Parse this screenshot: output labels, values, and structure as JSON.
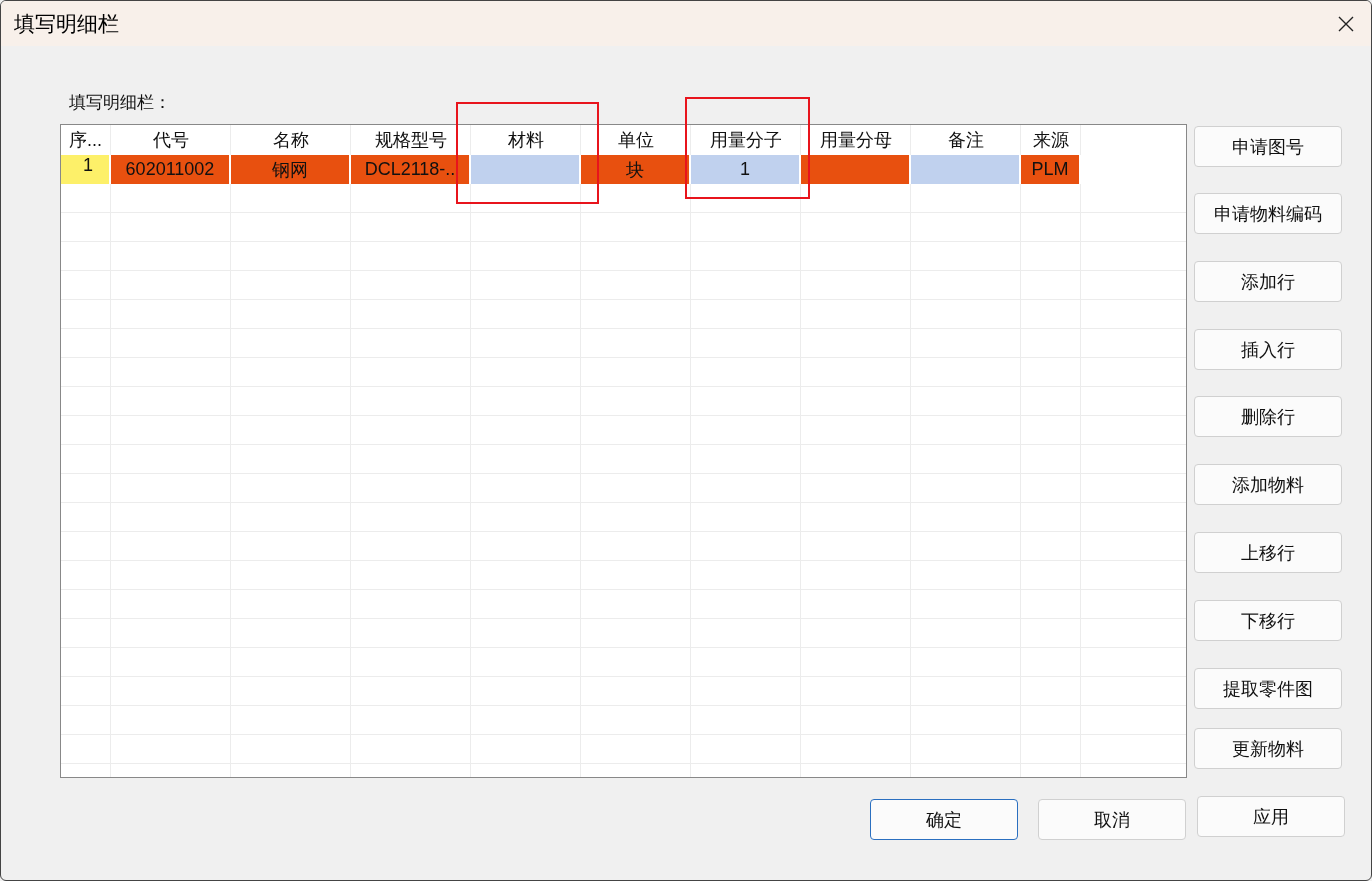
{
  "window": {
    "title": "填写明细栏"
  },
  "table_label": "填写明细栏：",
  "table": {
    "columns": [
      "序...",
      "代号",
      "名称",
      "规格型号",
      "材料",
      "单位",
      "用量分子",
      "用量分母",
      "备注",
      "来源"
    ],
    "rows": [
      {
        "cells": [
          {
            "text": "1",
            "color": "#fdf069"
          },
          {
            "text": "602011002",
            "color": "#e8500f"
          },
          {
            "text": "钢网",
            "color": "#e8500f"
          },
          {
            "text": "DCL2118-..",
            "color": "#e8500f"
          },
          {
            "color": "#c0d1ee"
          },
          {
            "text": "块",
            "color": "#e8500f"
          },
          {
            "text": "1",
            "color": "#c0d1ee"
          },
          {
            "color": "#e8500f"
          },
          {
            "color": "#c0d1ee"
          },
          {
            "text": "PLM",
            "color": "#e8500f"
          }
        ]
      }
    ]
  },
  "side_buttons": [
    "申请图号",
    "申请物料编码",
    "添加行",
    "插入行",
    "删除行",
    "添加物料",
    "上移行",
    "下移行",
    "提取零件图",
    "更新物料"
  ],
  "footer_buttons": [
    {
      "label": "确定",
      "default": true
    },
    {
      "label": "取消",
      "default": false
    },
    {
      "label": "应用",
      "default": false
    }
  ]
}
